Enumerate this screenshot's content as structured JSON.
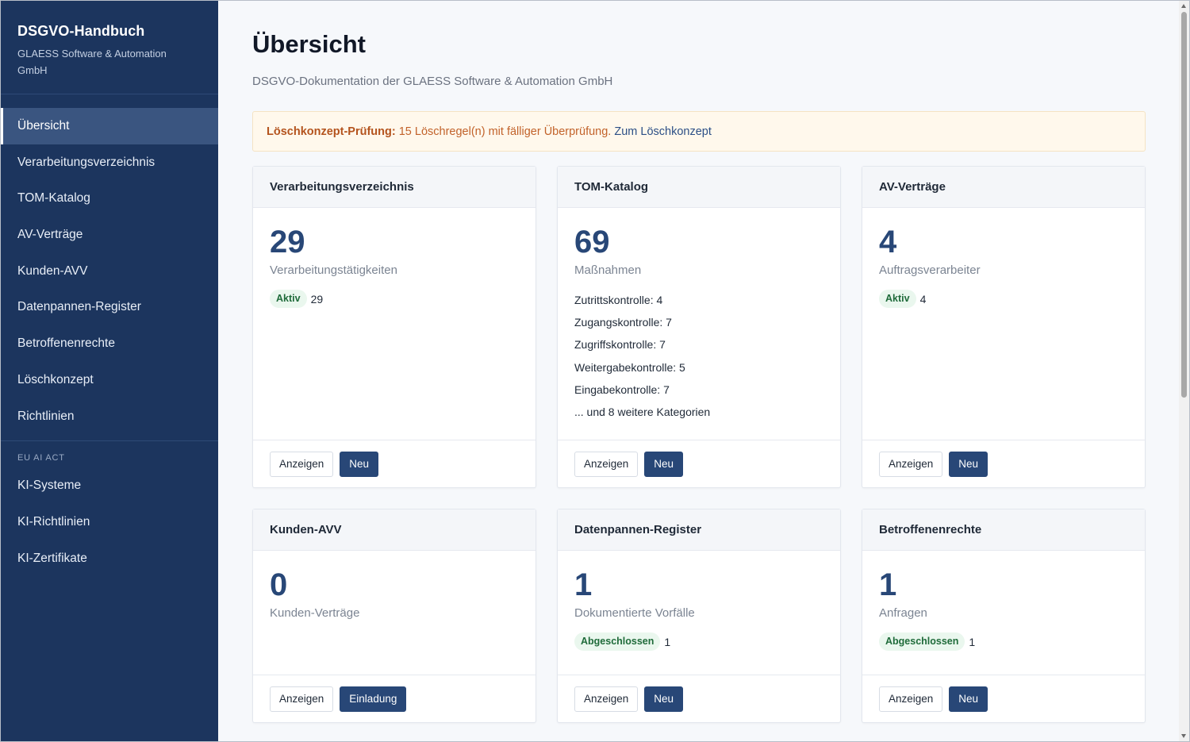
{
  "brand": {
    "title": "DSGVO-Handbuch",
    "subtitle": "GLAESS Software & Automation GmbH"
  },
  "sidebar": {
    "items": [
      {
        "label": "Übersicht",
        "active": true
      },
      {
        "label": "Verarbeitungsverzeichnis"
      },
      {
        "label": "TOM-Katalog"
      },
      {
        "label": "AV-Verträge"
      },
      {
        "label": "Kunden-AVV"
      },
      {
        "label": "Datenpannen-Register"
      },
      {
        "label": "Betroffenenrechte"
      },
      {
        "label": "Löschkonzept"
      },
      {
        "label": "Richtlinien"
      }
    ],
    "section_label": "EU AI ACT",
    "ai_items": [
      {
        "label": "KI-Systeme"
      },
      {
        "label": "KI-Richtlinien"
      },
      {
        "label": "KI-Zertifikate"
      }
    ]
  },
  "page": {
    "title": "Übersicht",
    "subtitle": "DSGVO-Dokumentation der GLAESS Software & Automation GmbH"
  },
  "alert": {
    "strong": "Löschkonzept-Prüfung:",
    "text": " 15 Löschregel(n) mit fälliger Überprüfung. ",
    "link": "Zum Löschkonzept"
  },
  "cards": [
    {
      "title": "Verarbeitungsverzeichnis",
      "count": "29",
      "unit": "Verarbeitungstätigkeiten",
      "badge": "Aktiv",
      "badge_value": "29",
      "view_label": "Anzeigen",
      "action_label": "Neu"
    },
    {
      "title": "TOM-Katalog",
      "count": "69",
      "unit": "Maßnahmen",
      "categories": [
        "Zutrittskontrolle: 4",
        "Zugangskontrolle: 7",
        "Zugriffskontrolle: 7",
        "Weitergabekontrolle: 5",
        "Eingabekontrolle: 7",
        "... und 8 weitere Kategorien"
      ],
      "view_label": "Anzeigen",
      "action_label": "Neu"
    },
    {
      "title": "AV-Verträge",
      "count": "4",
      "unit": "Auftragsverarbeiter",
      "badge": "Aktiv",
      "badge_value": "4",
      "view_label": "Anzeigen",
      "action_label": "Neu"
    },
    {
      "title": "Kunden-AVV",
      "count": "0",
      "unit": "Kunden-Verträge",
      "view_label": "Anzeigen",
      "action_label": "Einladung"
    },
    {
      "title": "Datenpannen-Register",
      "count": "1",
      "unit": "Dokumentierte Vorfälle",
      "badge": "Abgeschlossen",
      "badge_value": "1",
      "view_label": "Anzeigen",
      "action_label": "Neu"
    },
    {
      "title": "Betroffenenrechte",
      "count": "1",
      "unit": "Anfragen",
      "badge": "Abgeschlossen",
      "badge_value": "1",
      "view_label": "Anzeigen",
      "action_label": "Neu"
    }
  ],
  "colors": {
    "sidebar_bg": "#1c355e",
    "accent": "#284777",
    "alert_bg": "#fff8ec",
    "badge_bg": "#eaf7ee",
    "badge_text": "#1f6b3a"
  }
}
